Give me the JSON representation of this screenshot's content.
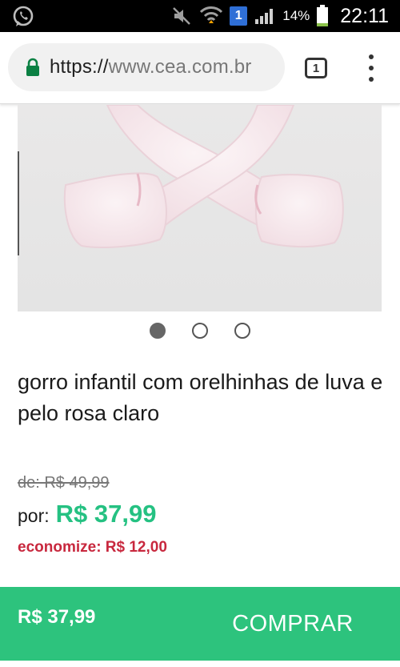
{
  "status_bar": {
    "battery_percent": "14%",
    "time": "22:11",
    "sim_badge": "1"
  },
  "browser": {
    "url_scheme": "https://",
    "url_host": "www.cea.com.br",
    "tab_count": "1"
  },
  "product": {
    "image_alt": "gorro infantil com orelhinhas de luva e pelo rosa claro",
    "carousel": {
      "total": 3,
      "active_index": 0
    },
    "title": "gorro infantil com orelhinhas de luva e pelo rosa claro",
    "old_price": "de: R$ 49,99",
    "price_prefix": "por:",
    "price": "R$ 37,99",
    "savings": "economize: R$ 12,00"
  },
  "buy_bar": {
    "price": "R$ 37,99",
    "button_label": "COMPRAR"
  },
  "colors": {
    "accent_green": "#2dc37d",
    "price_green": "#25c182",
    "savings_red": "#c8283e"
  }
}
